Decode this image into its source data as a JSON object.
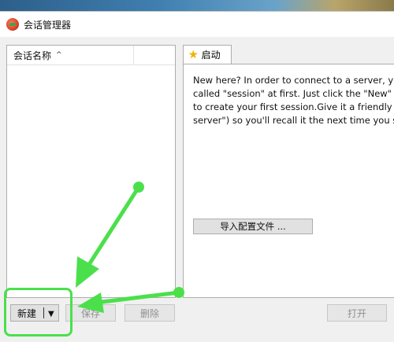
{
  "window": {
    "title": "会话管理器"
  },
  "session_list": {
    "column_header": "会话名称"
  },
  "tabs": [
    {
      "label": "启动"
    }
  ],
  "welcome": {
    "lines": [
      "New here? In order to connect to a server, yo",
      "called \"session\" at first. Just click the \"New\" b",
      "to create your first session.Give it a friendly n",
      "server\") so you'll recall it the next time you st"
    ]
  },
  "buttons": {
    "import_config": "导入配置文件 ...",
    "new": "新建",
    "save": "保存",
    "delete": "删除",
    "open": "打开"
  },
  "icons": {
    "app": "app-logo-icon",
    "tab": "star-icon",
    "sort": "sort-up-icon",
    "dropdown": "triangle-down-icon"
  },
  "colors": {
    "annotation": "#4be04b"
  }
}
